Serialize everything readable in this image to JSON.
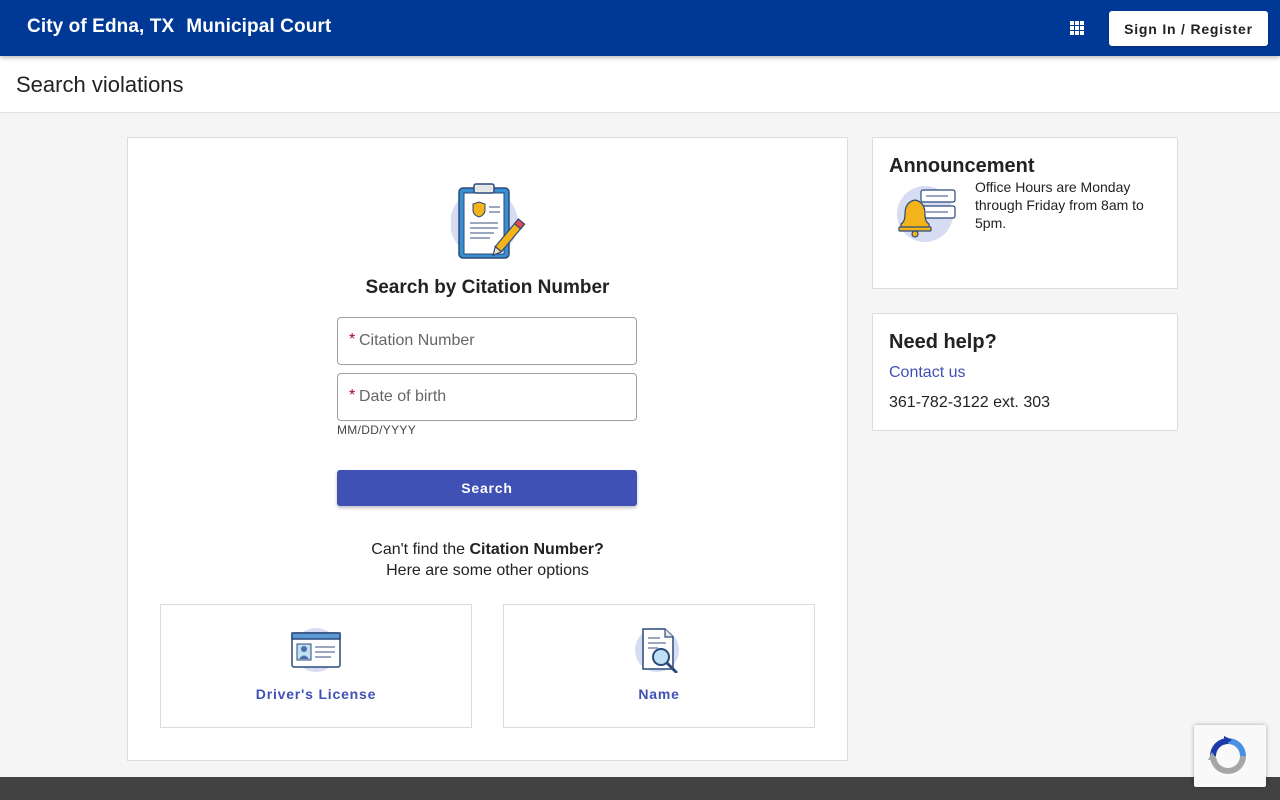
{
  "header": {
    "city": "City of Edna, TX",
    "court": "Municipal Court",
    "apps_icon": "apps-grid-icon",
    "signin_label": "Sign In / Register",
    "bg_color": "#003896"
  },
  "subheader": {
    "title": "Search violations"
  },
  "search": {
    "icon": "clipboard-citation-icon",
    "title": "Search by Citation Number",
    "citation_placeholder": "Citation Number",
    "dob_placeholder": "Date of birth",
    "required_mark": "*",
    "dob_hint": "MM/DD/YYYY",
    "button_label": "Search",
    "cant_find_prefix": "Can't find the ",
    "cant_find_bold": "Citation Number?",
    "cant_find_line2": "Here are some other options",
    "options": [
      {
        "label": "Driver's License",
        "icon": "id-card-icon"
      },
      {
        "label": "Name",
        "icon": "document-search-icon"
      }
    ],
    "accent_color": "#3f51b5"
  },
  "announcement": {
    "title": "Announcement",
    "icon": "bell-notification-icon",
    "message": "Office Hours are Monday through Friday from 8am to 5pm."
  },
  "help": {
    "title": "Need help?",
    "contact_label": "Contact us",
    "phone": "361-782-3122 ext. 303"
  },
  "recaptcha": {
    "icon": "recaptcha-icon"
  }
}
